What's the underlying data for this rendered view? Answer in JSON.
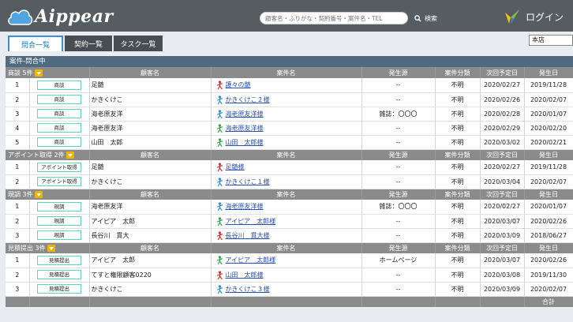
{
  "header": {
    "logo_text": "Aippear",
    "search_placeholder": "顧客名・ふりがな・契約番号・案件名・TEL",
    "search_label": "検索",
    "login_label": "ログイン"
  },
  "tabs": [
    {
      "label": "問合一覧",
      "active": true
    },
    {
      "label": "契約一覧",
      "active": false
    },
    {
      "label": "タスク一覧",
      "active": false
    }
  ],
  "store_select": "本店",
  "section_title": "案件-問合中",
  "columns": {
    "customer": "顧客名",
    "case": "案件名",
    "source": "発生源",
    "category": "案件分類",
    "next_date": "次回予定日",
    "date": "発生日"
  },
  "groups": [
    {
      "label": "商談 5件",
      "rows": [
        {
          "no": "1",
          "status": "商談",
          "customer": "足髄",
          "icon": "red",
          "case": "護々の髄",
          "source": "--",
          "category": "不明",
          "next": "2020/02/27",
          "date": "2019/11/28"
        },
        {
          "no": "2",
          "status": "商談",
          "customer": "かきくけこ",
          "icon": "blue",
          "case": "かきくけこ２様",
          "source": "--",
          "category": "不明",
          "next": "2020/02/26",
          "date": "2020/02/07"
        },
        {
          "no": "3",
          "status": "商談",
          "customer": "海老原友洋",
          "icon": "blue",
          "case": "海老原友洋様",
          "source": "雑誌：〇〇〇",
          "category": "不明",
          "next": "2020/02/28",
          "date": "2020/01/07"
        },
        {
          "no": "4",
          "status": "商談",
          "customer": "海老原友洋",
          "icon": "green",
          "case": "海老原友洋様",
          "source": "--",
          "category": "不明",
          "next": "2020/02/29",
          "date": "2020/02/20"
        },
        {
          "no": "5",
          "status": "商談",
          "customer": "山田　太郎",
          "icon": "green",
          "case": "山田　太郎様",
          "source": "--",
          "category": "不明",
          "next": "2020/03/02",
          "date": "2020/02/21"
        }
      ]
    },
    {
      "label": "アポイント取得 2件",
      "rows": [
        {
          "no": "1",
          "status": "アポイント取得",
          "customer": "足髄",
          "icon": "red",
          "case": "足髄様",
          "source": "--",
          "category": "不明",
          "next": "2020/02/27",
          "date": "2019/11/28"
        },
        {
          "no": "2",
          "status": "アポイント取得",
          "customer": "かきくけこ",
          "icon": "blue",
          "case": "かきくけこ１様",
          "source": "--",
          "category": "不明",
          "next": "2020/03/04",
          "date": "2020/02/07"
        }
      ]
    },
    {
      "label": "現調 3件",
      "rows": [
        {
          "no": "1",
          "status": "現調",
          "customer": "海老原友洋",
          "icon": "blue",
          "case": "海老原友洋様",
          "source": "雑誌：〇〇〇",
          "category": "不明",
          "next": "2020/02/27",
          "date": "2020/01/07"
        },
        {
          "no": "2",
          "status": "現調",
          "customer": "アイピア　太郎",
          "icon": "green",
          "case": "アイピア　太郎様",
          "source": "--",
          "category": "不明",
          "next": "2020/03/07",
          "date": "2020/02/26"
        },
        {
          "no": "3",
          "status": "現調",
          "customer": "長谷川　貫大",
          "icon": "red",
          "case": "長谷川　貫大様",
          "source": "--",
          "category": "不明",
          "next": "2020/03/09",
          "date": "2018/06/27"
        }
      ]
    },
    {
      "label": "見積提出 3件",
      "rows": [
        {
          "no": "1",
          "status": "見積提出",
          "customer": "アイピア　太郎",
          "icon": "green",
          "case": "アイピア　太郎様",
          "source": "ホームページ",
          "category": "不明",
          "next": "2020/03/07",
          "date": "2020/02/26"
        },
        {
          "no": "2",
          "status": "見積提出",
          "customer": "てすと権限顧客0220",
          "icon": "red",
          "case": "山田　太郎様",
          "source": "--",
          "category": "不明",
          "next": "2020/03/08",
          "date": "2019/11/30"
        },
        {
          "no": "3",
          "status": "見積提出",
          "customer": "かきくけこ",
          "icon": "blue",
          "case": "かきくけこ３様",
          "source": "--",
          "category": "不明",
          "next": "2020/03/09",
          "date": "2020/02/07"
        }
      ]
    }
  ],
  "footer_total": "合計",
  "colors": {
    "header": "#565d62",
    "section": "#4f6b81",
    "group": "#8b8b8b",
    "link": "#2a4fb3",
    "badge_border": "#62d8b5"
  }
}
